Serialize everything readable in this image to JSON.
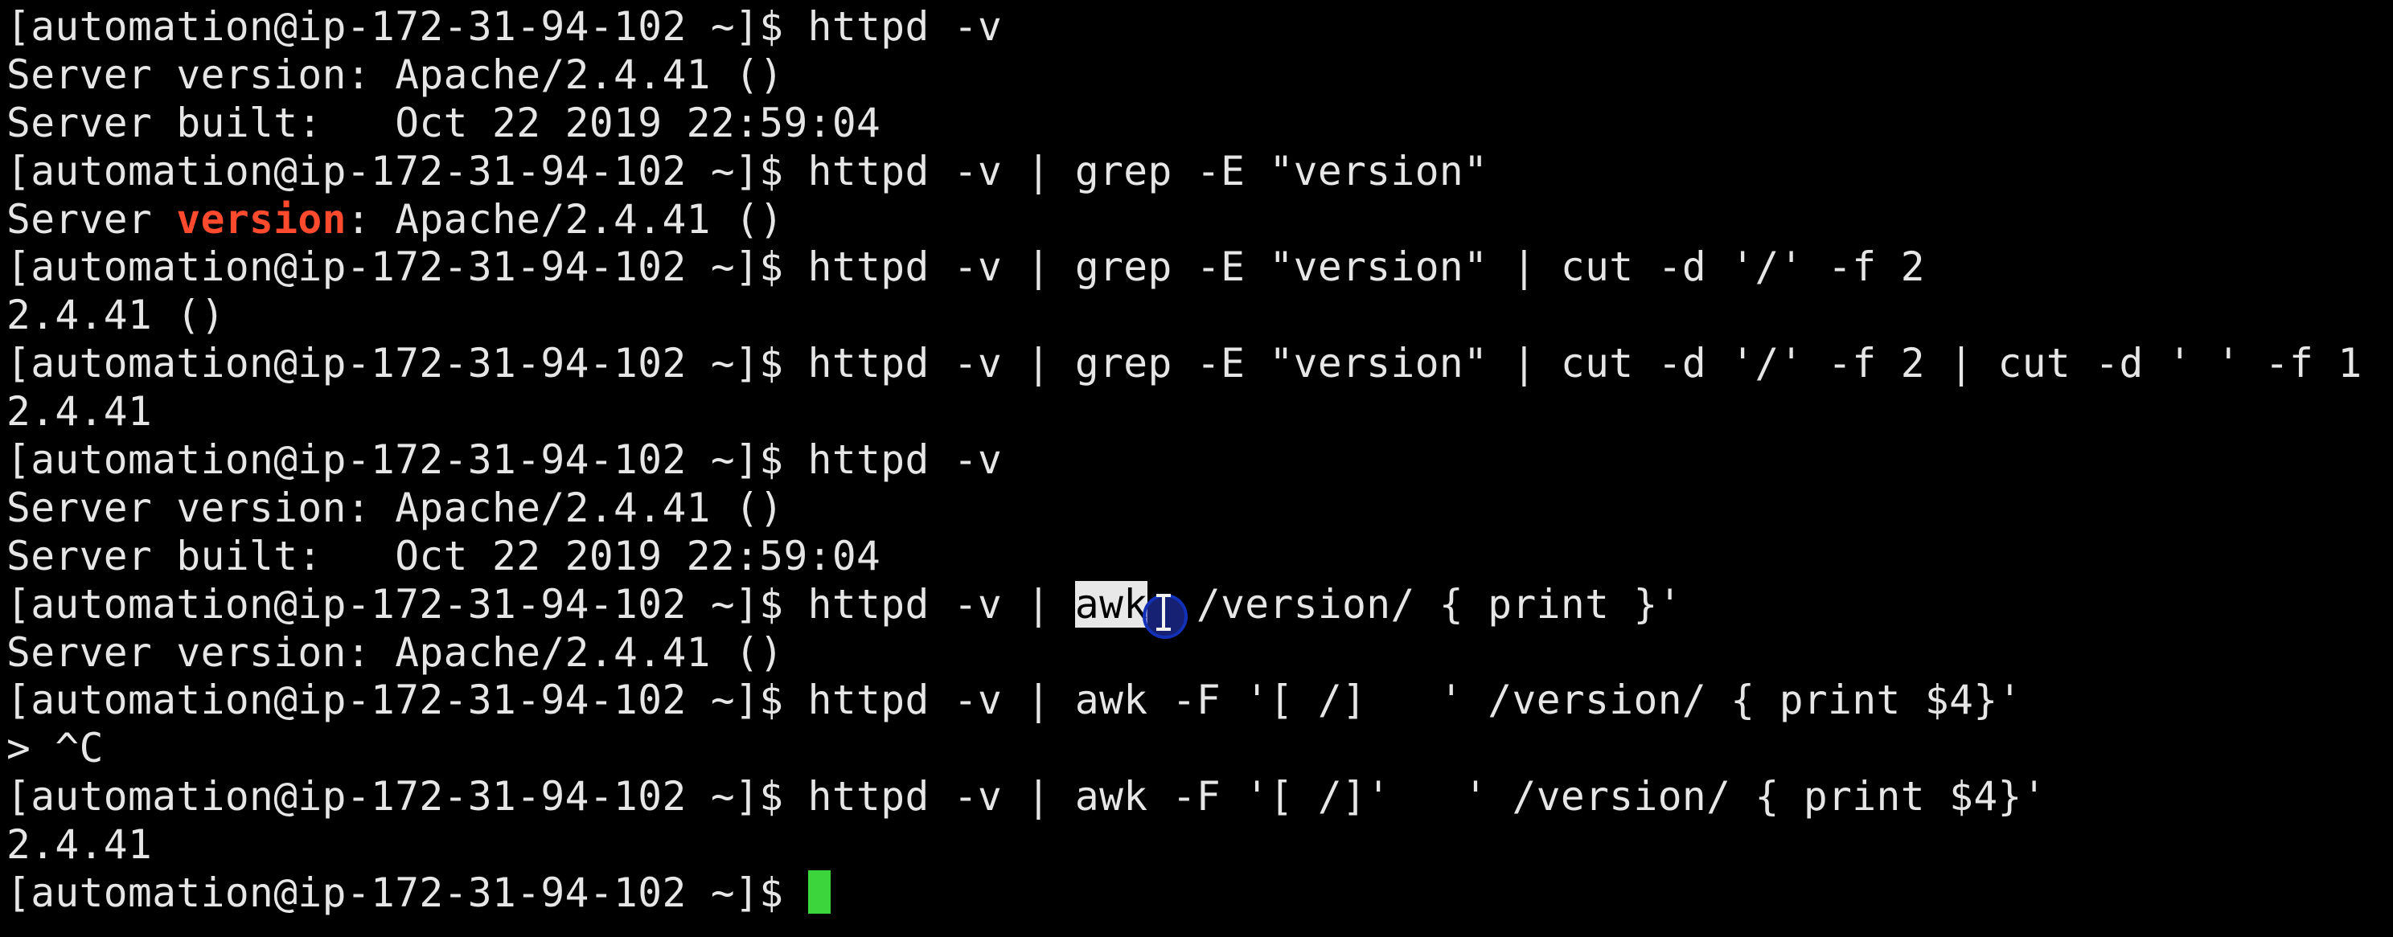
{
  "terminal": {
    "lines": [
      "[automation@ip-172-31-94-102 ~]$ httpd -v",
      "Server version: Apache/2.4.41 ()",
      "Server built:   Oct 22 2019 22:59:04",
      "[automation@ip-172-31-94-102 ~]$ httpd -v | grep -E \"version\"",
      {
        "before": "Server ",
        "match": "version",
        "after": ": Apache/2.4.41 ()"
      },
      "[automation@ip-172-31-94-102 ~]$ httpd -v | grep -E \"version\" | cut -d '/' -f 2",
      "2.4.41 ()",
      "[automation@ip-172-31-94-102 ~]$ httpd -v | grep -E \"version\" | cut -d '/' -f 2 | cut -d ' ' -f 1",
      "2.4.41",
      "[automation@ip-172-31-94-102 ~]$ httpd -v",
      "Server version: Apache/2.4.41 ()",
      "Server built:   Oct 22 2019 22:59:04",
      {
        "before": "[automation@ip-172-31-94-102 ~]$ httpd -v | ",
        "selected": "awk",
        "after": "  /version/ { print }'"
      },
      "Server version: Apache/2.4.41 ()",
      "[automation@ip-172-31-94-102 ~]$ httpd -v | awk -F '[ /]   ' /version/ { print $4}'",
      "> ^C",
      "[automation@ip-172-31-94-102 ~]$ httpd -v | awk -F '[ /]'   ' /version/ { print $4}'",
      "2.4.41",
      {
        "prompt": "[automation@ip-172-31-94-102 ~]$ "
      }
    ]
  },
  "colors": {
    "background": "#000000",
    "text": "#e6e6e6",
    "grep_match": "#ff4a2e",
    "selection_bg": "#e8e8e8",
    "cursor": "#3cd63c",
    "click_indicator": "#1230b8"
  },
  "icons": {
    "mouse_pointer": "i-beam-cursor-icon",
    "text_cursor": "block-cursor"
  }
}
